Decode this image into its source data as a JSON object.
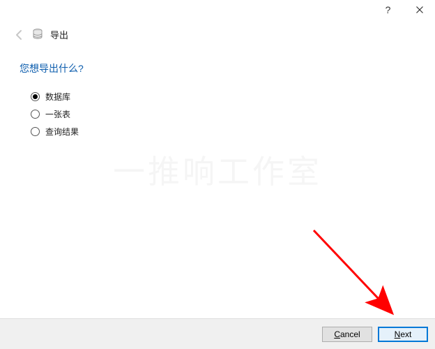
{
  "titlebar": {
    "help_symbol": "?",
    "close_label": "Close"
  },
  "header": {
    "title": "导出"
  },
  "question": "您想导出什么?",
  "options": [
    {
      "label": "数据库",
      "checked": true
    },
    {
      "label": "一张表",
      "checked": false
    },
    {
      "label": "查询结果",
      "checked": false
    }
  ],
  "watermark": "一推响工作室",
  "footer": {
    "cancel": {
      "mnemonic": "C",
      "rest": "ancel"
    },
    "next": {
      "mnemonic": "N",
      "rest": "ext"
    }
  }
}
